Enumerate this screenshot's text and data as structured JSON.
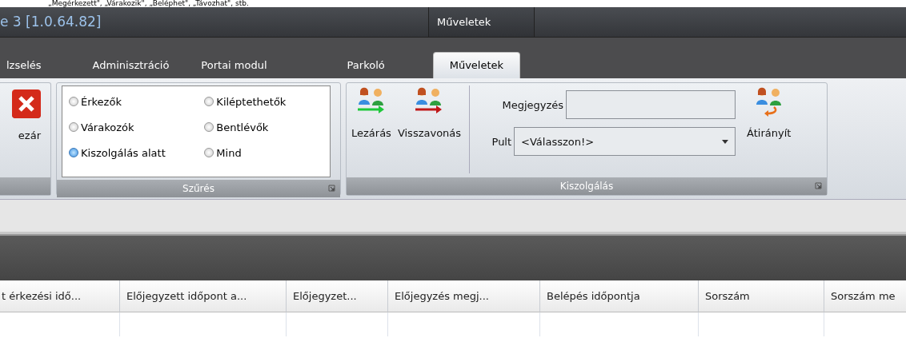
{
  "top_note": "„Megérkezett\", „Várakozik\", „Beléphet\", „Távozhat\", stb.",
  "window": {
    "title": "e 3 [1.0.64.82]",
    "context_group": "Műveletek"
  },
  "tabs": [
    {
      "label": "lzselés",
      "selected": false
    },
    {
      "label": "Adminisztráció",
      "selected": false
    },
    {
      "label": "Portai modul",
      "selected": false
    },
    {
      "label": "Parkoló",
      "selected": false
    },
    {
      "label": "Műveletek",
      "selected": true
    }
  ],
  "ribbon": {
    "close_group": {
      "button": "ezár"
    },
    "filter_group": {
      "title": "Szűrés",
      "options": [
        {
          "label": "Érkezők",
          "selected": false
        },
        {
          "label": "Kiléptethetők",
          "selected": false
        },
        {
          "label": "Várakozók",
          "selected": false
        },
        {
          "label": "Bentlévők",
          "selected": false
        },
        {
          "label": "Kiszolgálás alatt",
          "selected": true
        },
        {
          "label": "Mind",
          "selected": false
        }
      ]
    },
    "service_group": {
      "title": "Kiszolgálás",
      "buttons": [
        {
          "label": "Lezárás",
          "kind": "close"
        },
        {
          "label": "Visszavonás",
          "kind": "revoke"
        }
      ],
      "note_label": "Megjegyzés",
      "desk_label": "Pult",
      "desk_value": "<Válasszon!>",
      "redirect_button": {
        "label": "Átirányít",
        "kind": "redirect"
      }
    }
  },
  "table": {
    "columns": [
      "t érkezési idő...",
      "Előjegyzett időpont a...",
      "Előjegyzet...",
      "Előjegyzés megj...",
      "Belépés időpontja",
      "Sorszám",
      "Sorszám me"
    ]
  }
}
